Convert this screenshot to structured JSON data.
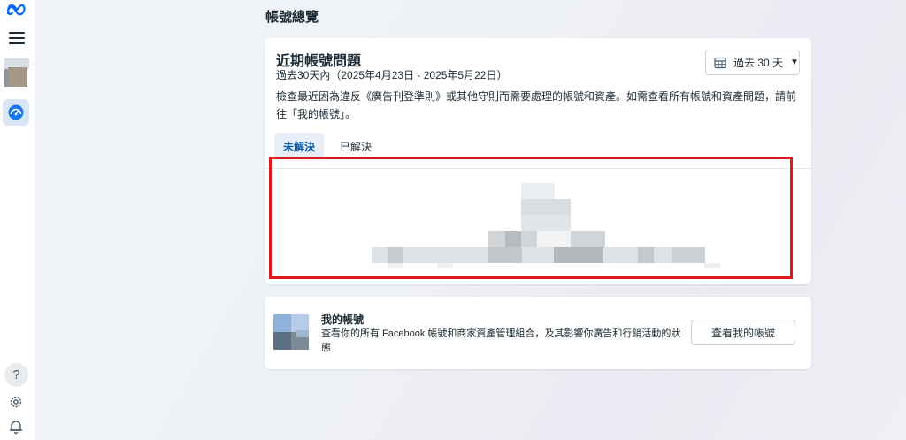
{
  "page": {
    "title": "帳號總覽"
  },
  "sidebar": {
    "help_label": "?"
  },
  "issues": {
    "title": "近期帳號問題",
    "date_range": "過去30天內（2025年4月23日 - 2025年5月22日）",
    "description": "檢查最近因為違反《廣告刊登準則》或其他守則而需要處理的帳號和資產。如需查看所有帳號和資產問題，請前往「我的帳號」。",
    "range_select": "過去 30 天",
    "tabs": [
      {
        "label": "未解決",
        "active": true
      },
      {
        "label": "已解決",
        "active": false
      }
    ]
  },
  "my_accounts": {
    "title": "我的帳號",
    "description": "查看你的所有 Facebook 帳號和商家資產管理組合，及其影響你廣告和行銷活動的狀態",
    "button_label": "查看我的帳號"
  },
  "colors": {
    "accent": "#0a5ba8",
    "highlight": "#e0191f",
    "active_tab_bg": "#e7eef8"
  }
}
